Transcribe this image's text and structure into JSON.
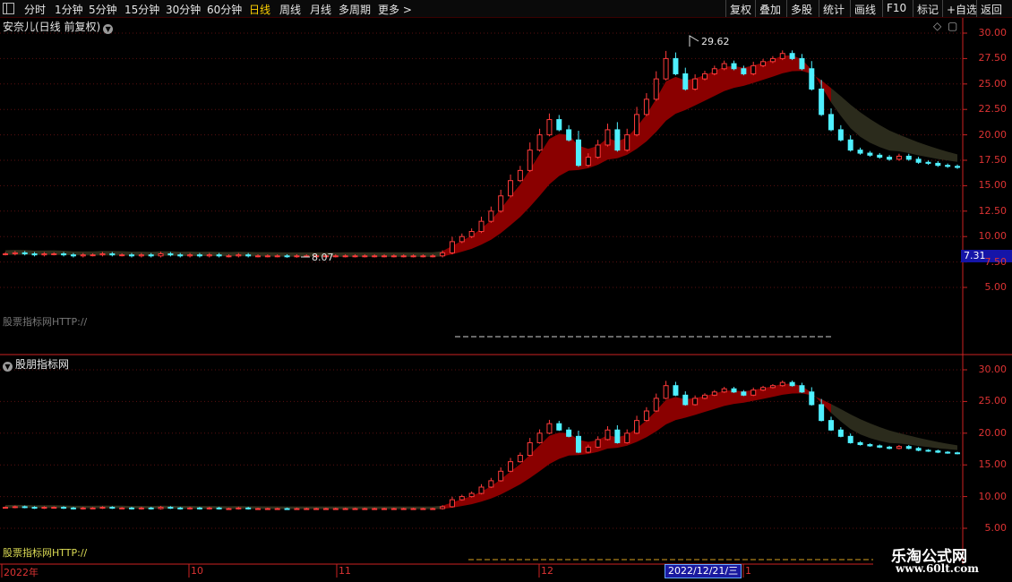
{
  "toolbar": {
    "periods": [
      "分时",
      "1分钟",
      "5分钟",
      "15分钟",
      "30分钟",
      "60分钟",
      "日线",
      "周线",
      "月线",
      "多周期",
      "更多 >"
    ],
    "active_period": "日线",
    "actions": [
      "复权",
      "叠加",
      "多股",
      "统计",
      "画线",
      "F10",
      "标记",
      "+自选",
      "返回"
    ]
  },
  "top_panel": {
    "title": "安奈儿(日线 前复权)",
    "peak_label": "29.62",
    "low_label": "8.07",
    "current_price": "7.31",
    "y_ticks": [
      "30.00",
      "27.50",
      "25.00",
      "22.50",
      "20.00",
      "17.50",
      "15.00",
      "12.50",
      "10.00",
      "7.50",
      "5.00"
    ],
    "url_text": "股票指标网HTTP://"
  },
  "bottom_panel": {
    "title": "股朋指标网",
    "y_ticks": [
      "30.00",
      "25.00",
      "20.00",
      "15.00",
      "10.00",
      "5.00"
    ],
    "url_text": "股票指标网HTTP://"
  },
  "date_axis": {
    "labels": [
      "2022年",
      "10",
      "11",
      "12",
      "1"
    ],
    "cursor_date": "2022/12/21/三"
  },
  "watermark": {
    "name": "乐淘公式网",
    "url": "www.60lt.com"
  },
  "colors": {
    "up": "#ff3a3a",
    "down": "#4ff0ff",
    "band_dark_red": "#8a0000",
    "band_olive": "#2b2b1c",
    "axis": "#cc2222"
  },
  "chart_data": {
    "type": "candlestick",
    "price_range": [
      5,
      30
    ],
    "series_close": [
      8.3,
      8.4,
      8.3,
      8.2,
      8.3,
      8.3,
      8.2,
      8.1,
      8.2,
      8.2,
      8.3,
      8.2,
      8.2,
      8.1,
      8.2,
      8.1,
      8.3,
      8.2,
      8.1,
      8.2,
      8.1,
      8.2,
      8.1,
      8.1,
      8.2,
      8.1,
      8.1,
      8.1,
      8.1,
      8.07,
      8.1,
      8.1,
      8.1,
      8.1,
      8.1,
      8.1,
      8.1,
      8.1,
      8.1,
      8.1,
      8.1,
      8.1,
      8.1,
      8.1,
      8.1,
      8.4,
      9.5,
      10.0,
      10.5,
      11.5,
      12.5,
      14.0,
      15.5,
      16.5,
      18.5,
      20.0,
      21.5,
      20.5,
      19.5,
      17.0,
      17.8,
      19.0,
      20.5,
      18.5,
      20.0,
      22.0,
      23.5,
      25.5,
      27.5,
      26.0,
      24.5,
      25.5,
      26.0,
      26.5,
      27.0,
      26.5,
      26.0,
      26.8,
      27.2,
      27.5,
      28.0,
      27.5,
      26.5,
      24.5,
      22.0,
      20.5,
      19.5,
      18.5,
      18.2,
      18.0,
      17.8,
      17.6,
      17.9,
      17.6,
      17.3,
      17.2,
      17.0,
      16.9,
      16.8
    ]
  }
}
